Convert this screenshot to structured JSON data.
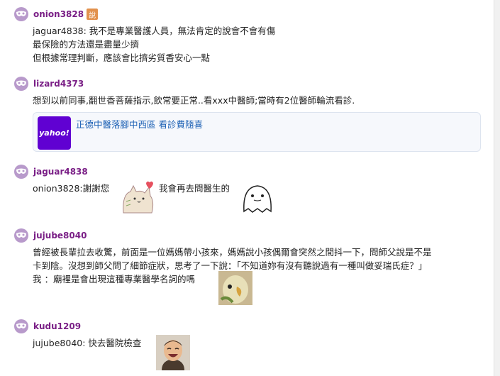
{
  "posts": [
    {
      "username": "onion3828",
      "op_badge": "說",
      "lines": [
        "jaguar4838: 我不是專業醫護人員，無法肯定的說會不會有傷",
        "最保險的方法還是盡量少擠",
        "但根據常理判斷，應該會比擠劣質香安心一點"
      ]
    },
    {
      "username": "lizard4373",
      "lines": [
        "想到以前同事,翻世香菩薩指示,飲常要正常..看xxx中醫師;當時有2位醫師輪流看診."
      ],
      "link_card": {
        "logo_text": "yahoo!",
        "title": "正德中醫落腳中西區 看診費隨喜"
      }
    },
    {
      "username": "jaguar4838",
      "text_a": "onion3828:謝謝您",
      "text_b": "我會再去問醫生的"
    },
    {
      "username": "jujube8040",
      "lines": [
        "曾經被長輩拉去收驚，前面是一位媽媽帶小孩來，媽媽說小孩偶爾會突然之間抖一下，問師父說是不是",
        "卡到陰。沒想到師父問了細節症狀，思考了一下說：「不知道妳有沒有聽說過有一種叫做妥瑞氏症？」",
        "我 ：廟裡是會出現這種專業醫學名詞的嗎"
      ]
    },
    {
      "username": "kudu1209",
      "text_a": "jujube8040: 快去醫院檢查"
    }
  ]
}
